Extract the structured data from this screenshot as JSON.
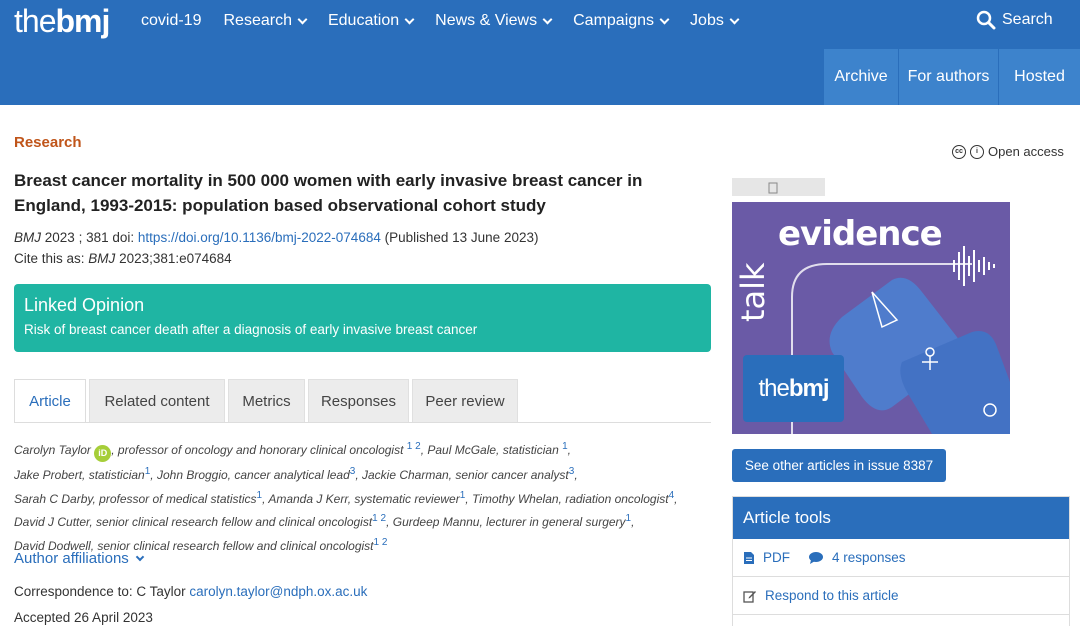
{
  "header": {
    "logo_light": "the",
    "logo_bold": "bmj",
    "nav": [
      {
        "label": "covid-19",
        "has_dropdown": false
      },
      {
        "label": "Research",
        "has_dropdown": true
      },
      {
        "label": "Education",
        "has_dropdown": true
      },
      {
        "label": "News & Views",
        "has_dropdown": true
      },
      {
        "label": "Campaigns",
        "has_dropdown": true
      },
      {
        "label": "Jobs",
        "has_dropdown": true
      }
    ],
    "search_label": "Search",
    "subnav": [
      "Archive",
      "For authors",
      "Hosted"
    ]
  },
  "article": {
    "section": "Research",
    "title": "Breast cancer mortality in 500 000 women with early invasive breast cancer in England, 1993-2015: population based observational cohort study",
    "journal": "BMJ",
    "year": "2023",
    "volume": "; 381",
    "doi_label": "doi:",
    "doi_link": "https://doi.org/10.1136/bmj-2022-074684",
    "published": "(Published 13 June 2023)",
    "cite_label": "Cite this as:",
    "cite_value": "2023;381:e074684",
    "linked_opinion": {
      "heading": "Linked Opinion",
      "text": "Risk of breast cancer death after a diagnosis of early invasive breast cancer"
    },
    "tabs": [
      "Article",
      "Related content",
      "Metrics",
      "Responses",
      "Peer review"
    ],
    "authors_line1_a": "Carolyn Taylor",
    "orcid": "iD",
    "authors_line1_b": ", professor of oncology and honorary clinical oncologist",
    "authors_line1_sup": "1  2",
    "authors_line1_c": ",  Paul McGale, statistician",
    "authors_line1_sup2": "1",
    "authors_line2_a": "Jake Probert, statistician",
    "authors_line2_sup": "1",
    "authors_line2_b": ",  John Broggio, cancer analytical lead",
    "authors_line2_sup2": "3",
    "authors_line2_c": ",  Jackie Charman, senior cancer analyst",
    "authors_line2_sup3": "3",
    "authors_line3_a": "Sarah C Darby, professor of medical statistics",
    "authors_line3_sup": "1",
    "authors_line3_b": ",  Amanda J Kerr, systematic reviewer",
    "authors_line3_sup2": "1",
    "authors_line3_c": ",  Timothy Whelan, radiation oncologist",
    "authors_line3_sup3": "4",
    "authors_line4_a": "David J Cutter, senior clinical research fellow and clinical oncologist",
    "authors_line4_sup": "1  2",
    "authors_line4_b": ",  Gurdeep Mannu, lecturer in general surgery",
    "authors_line4_sup2": "1",
    "authors_line5_a": "David Dodwell, senior clinical research fellow and clinical oncologist",
    "authors_line5_sup": "1  2",
    "affiliations_label": "Author affiliations",
    "correspondence_label": "Correspondence to: C Taylor",
    "correspondence_email": "carolyn.taylor@ndph.ox.ac.uk",
    "accepted": "Accepted 26 April 2023"
  },
  "sidebar": {
    "open_access": "Open access",
    "ad": {
      "word_evidence": "evidence",
      "word_talk": "talk",
      "logo_light": "the",
      "logo_bold": "bmj"
    },
    "issue_button": "See other articles in issue 8387",
    "tools": {
      "heading": "Article tools",
      "pdf": "PDF",
      "responses": "4 responses",
      "respond": "Respond to this article"
    }
  },
  "colors": {
    "brand_blue": "#2a6ebb",
    "research_orange": "#c0551a",
    "linked_teal": "#1fb5a3",
    "ad_purple": "#6a5aa6"
  }
}
